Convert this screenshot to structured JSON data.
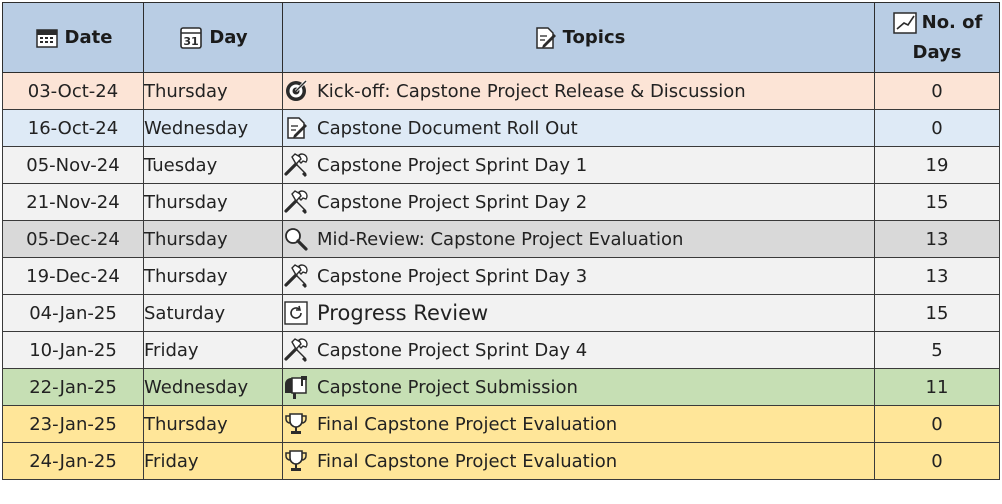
{
  "headers": {
    "date": "Date",
    "day": "Day",
    "topics": "Topics",
    "days_line1": "No. of",
    "days_line2": "Days"
  },
  "header_icons": {
    "date": "calendar-keypad-icon",
    "day": "calendar-31-icon",
    "topics": "document-edit-icon",
    "days": "chart-line-icon"
  },
  "rows": [
    {
      "date": "03-Oct-24",
      "day": "Thursday",
      "topic": "Kick-off: Capstone Project Release & Discussion",
      "days": "0",
      "icon": "target-icon",
      "color": "#fce4d6"
    },
    {
      "date": "16-Oct-24",
      "day": "Wednesday",
      "topic": "Capstone Document Roll Out",
      "days": "0",
      "icon": "document-edit-icon",
      "color": "#deeaf6"
    },
    {
      "date": "05-Nov-24",
      "day": "Tuesday",
      "topic": "Capstone Project Sprint Day 1",
      "days": "19",
      "icon": "tools-icon",
      "color": "#f2f2f2"
    },
    {
      "date": "21-Nov-24",
      "day": "Thursday",
      "topic": "Capstone Project Sprint Day 2",
      "days": "15",
      "icon": "tools-icon",
      "color": "#f2f2f2"
    },
    {
      "date": "05-Dec-24",
      "day": "Thursday",
      "topic": "Mid-Review: Capstone Project Evaluation",
      "days": "13",
      "icon": "magnifier-icon",
      "color": "#d9d9d9"
    },
    {
      "date": "19-Dec-24",
      "day": "Thursday",
      "topic": "Capstone Project Sprint Day 3",
      "days": "13",
      "icon": "tools-icon",
      "color": "#f2f2f2"
    },
    {
      "date": "04-Jan-25",
      "day": "Saturday",
      "topic": "Progress Review",
      "days": "15",
      "icon": "refresh-icon",
      "color": "#f2f2f2"
    },
    {
      "date": "10-Jan-25",
      "day": "Friday",
      "topic": "Capstone Project Sprint Day 4",
      "days": "5",
      "icon": "tools-icon",
      "color": "#f2f2f2"
    },
    {
      "date": "22-Jan-25",
      "day": "Wednesday",
      "topic": "Capstone Project Submission",
      "days": "11",
      "icon": "mailbox-icon",
      "color": "#c6dfb4"
    },
    {
      "date": "23-Jan-25",
      "day": "Thursday",
      "topic": "Final Capstone Project Evaluation",
      "days": "0",
      "icon": "trophy-icon",
      "color": "#ffe699"
    },
    {
      "date": "24-Jan-25",
      "day": "Friday",
      "topic": "Final Capstone Project Evaluation",
      "days": "0",
      "icon": "trophy-icon",
      "color": "#ffe699"
    }
  ]
}
